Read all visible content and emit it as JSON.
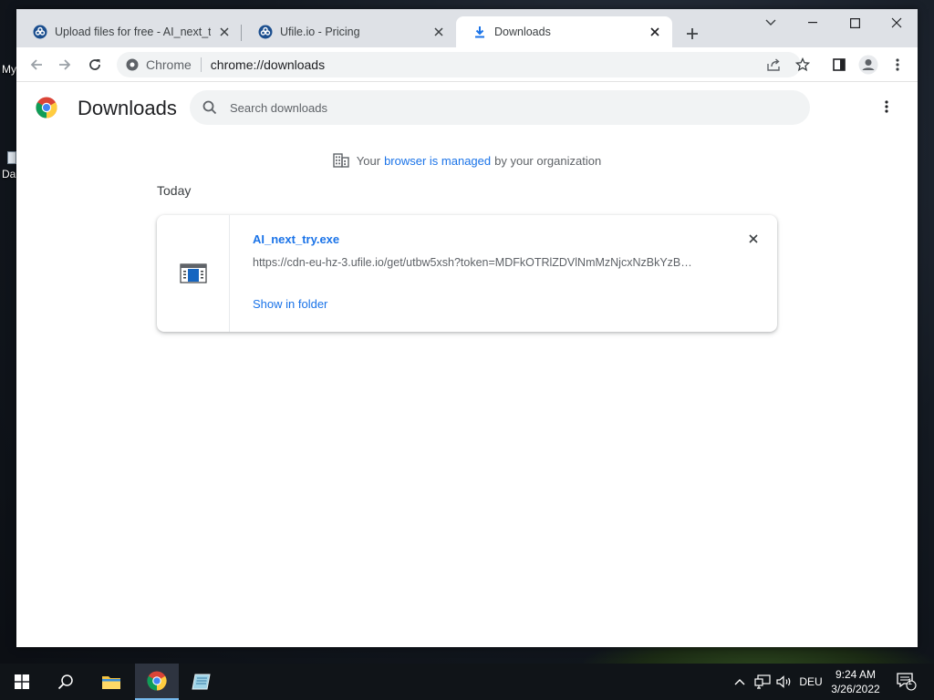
{
  "desktop": {
    "label_1": "My",
    "label_2": "Da"
  },
  "tabs": [
    {
      "title": "Upload files for free - AI_next_try",
      "favicon": "ufile-logo-icon"
    },
    {
      "title": "Ufile.io - Pricing",
      "favicon": "ufile-logo-icon"
    },
    {
      "title": "Downloads",
      "favicon": "download-arrow-icon"
    }
  ],
  "omnibox": {
    "chip_label": "Chrome",
    "url": "chrome://downloads"
  },
  "page": {
    "title": "Downloads",
    "search_placeholder": "Search downloads",
    "managed": {
      "prefix": "Your",
      "link": "browser is managed",
      "suffix": "by your organization"
    },
    "date_header": "Today",
    "download": {
      "filename": "AI_next_try.exe",
      "url": "https://cdn-eu-hz-3.ufile.io/get/utbw5xsh?token=MDFkOTRlZDVlNmMzNjcxNzBkYzB…",
      "action": "Show in folder"
    }
  },
  "taskbar": {
    "language": "DEU",
    "time": "9:24 AM",
    "date": "3/26/2022",
    "notification_count": "1"
  },
  "colors": {
    "accent": "#1a73e8",
    "tabstrip": "#dee1e6",
    "taskbar": "#101418"
  }
}
